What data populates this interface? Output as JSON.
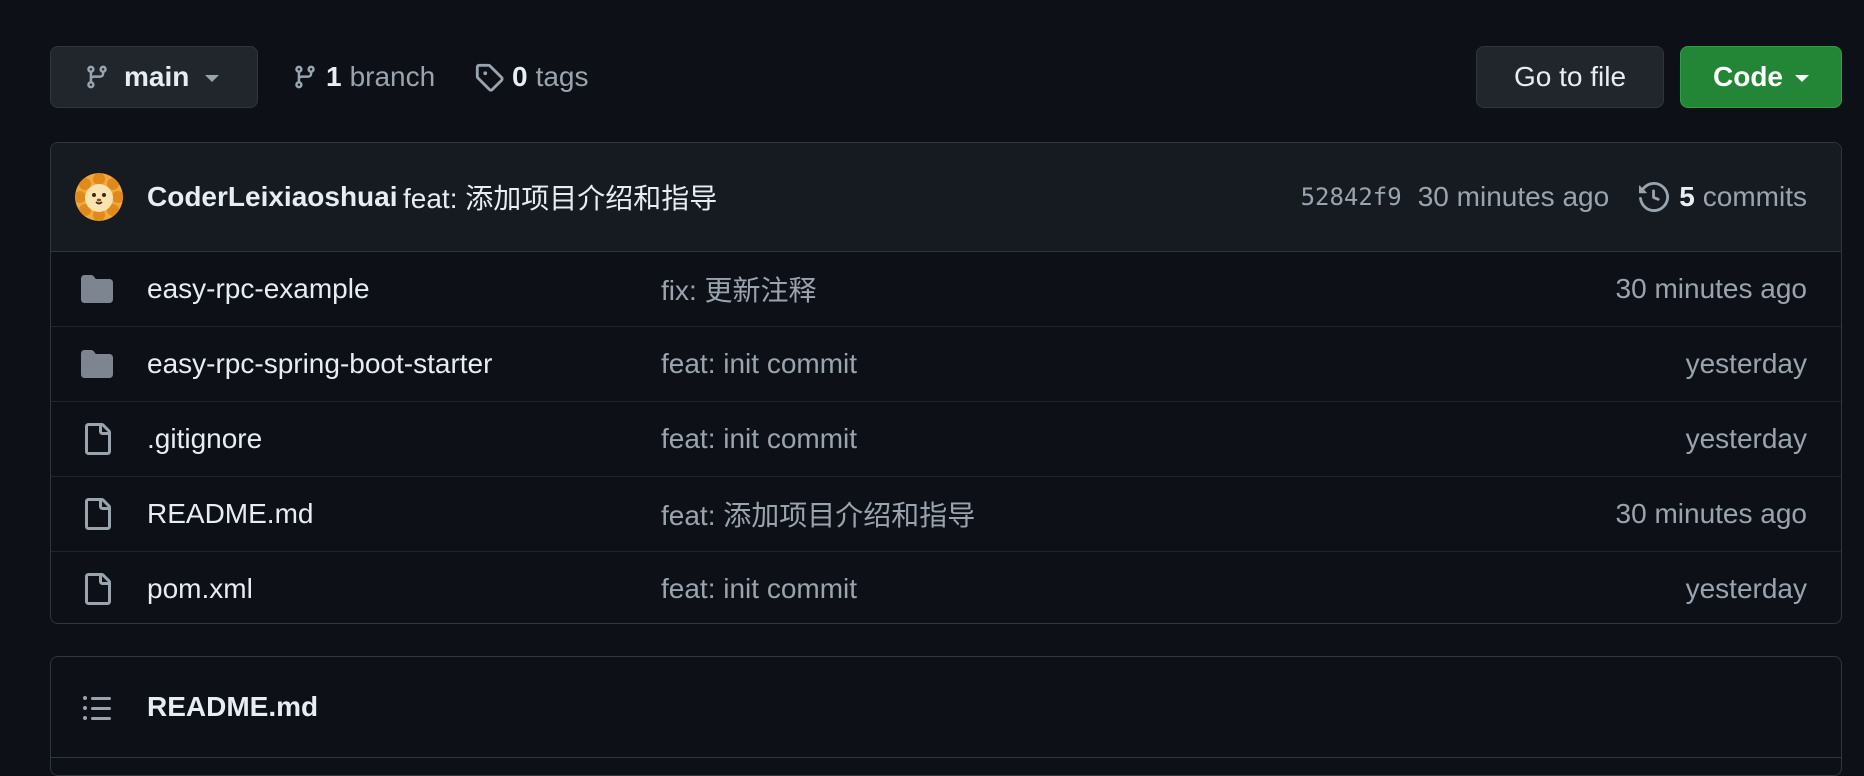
{
  "toolbar": {
    "branch_name": "main",
    "branch_count": "1",
    "branch_label": "branch",
    "tag_count": "0",
    "tag_label": "tags",
    "goto_label": "Go to file",
    "code_label": "Code"
  },
  "latest_commit": {
    "author": "CoderLeixiaoshuai",
    "message": "feat: 添加项目介绍和指导",
    "sha": "52842f9",
    "time": "30 minutes ago",
    "commit_count": "5",
    "commit_label": "commits"
  },
  "files": [
    {
      "type": "folder",
      "name": "easy-rpc-example",
      "commit": "fix: 更新注释",
      "time": "30 minutes ago"
    },
    {
      "type": "folder",
      "name": "easy-rpc-spring-boot-starter",
      "commit": "feat: init commit",
      "time": "yesterday"
    },
    {
      "type": "file",
      "name": ".gitignore",
      "commit": "feat: init commit",
      "time": "yesterday"
    },
    {
      "type": "file",
      "name": "README.md",
      "commit": "feat: 添加项目介绍和指导",
      "time": "30 minutes ago"
    },
    {
      "type": "file",
      "name": "pom.xml",
      "commit": "feat: init commit",
      "time": "yesterday"
    }
  ],
  "readme": {
    "title": "README.md"
  },
  "colors": {
    "background": "#0d1117",
    "accent_green": "#238636",
    "muted_text": "#9aa4ae",
    "folder_icon": "#7d8590"
  }
}
